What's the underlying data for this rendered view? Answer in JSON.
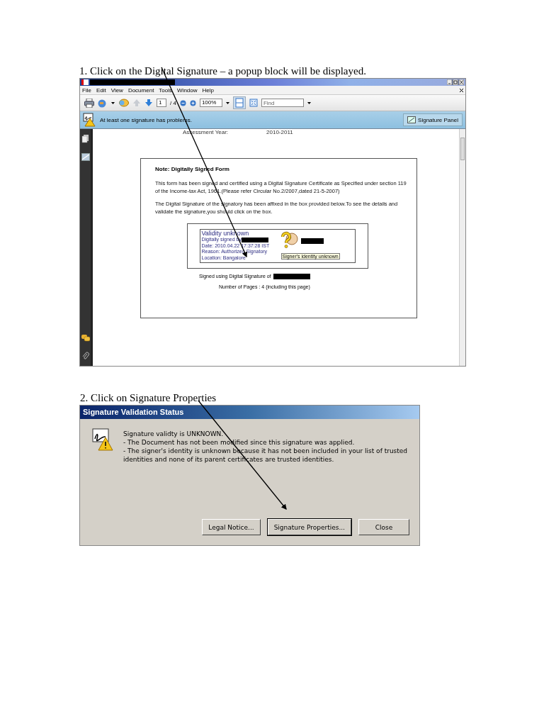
{
  "step_1": {
    "instruction": "1. Click on the Digital Signature – a popup block will be displayed.",
    "reader_window": {
      "menu": [
        "File",
        "Edit",
        "View",
        "Document",
        "Tools",
        "Window",
        "Help"
      ],
      "toolbar": {
        "page_number": "1",
        "page_total": "/ 4",
        "zoom": "100%",
        "find_placeholder": "Find"
      },
      "message_bar": {
        "text": "At least one signature has problems.",
        "button": "Signature Panel"
      },
      "document": {
        "top_label": "Assessment Year:",
        "top_value": "2010-2011",
        "note_title": "Note: Digitally Signed Form",
        "paragraphs": [
          "This form has been signed and certified using a Digital Signature Certificate as Specified under section 119 of the Income-tax Act, 1961.(Please refer Circular No.2/2007,dated 21-5-2007)",
          "The Digital Signature of the signatory has been affixed in the box provided below.To see the details and validate the signature,you should click on the box."
        ],
        "signature": {
          "heading": "Validity unknown",
          "lines": [
            "Digitally signed by",
            "Date: 2010.04.22 17:37:28 IST",
            "Reason: Authorized Signatory",
            "Location: Bangalore"
          ],
          "tooltip": "Signer's identity unknown"
        },
        "signed_using": "Signed using Digital Signature of",
        "page_count": "Number of Pages : 4 (including this page)"
      }
    }
  },
  "step_2": {
    "instruction": "2. Click on Signature Properties",
    "dialog": {
      "title": "Signature Validation Status",
      "message": [
        "Signature validty is UNKNOWN.",
        "- The Document has not been modified since this signature was applied.",
        "- The signer's identity is unknown because it has not been included in your list of trusted identities and none of its parent certificates are trusted identities."
      ],
      "buttons": [
        {
          "label": "Legal Notice...",
          "default": false
        },
        {
          "label": "Signature Properties...",
          "default": true
        },
        {
          "label": "Close",
          "default": false
        }
      ]
    }
  }
}
